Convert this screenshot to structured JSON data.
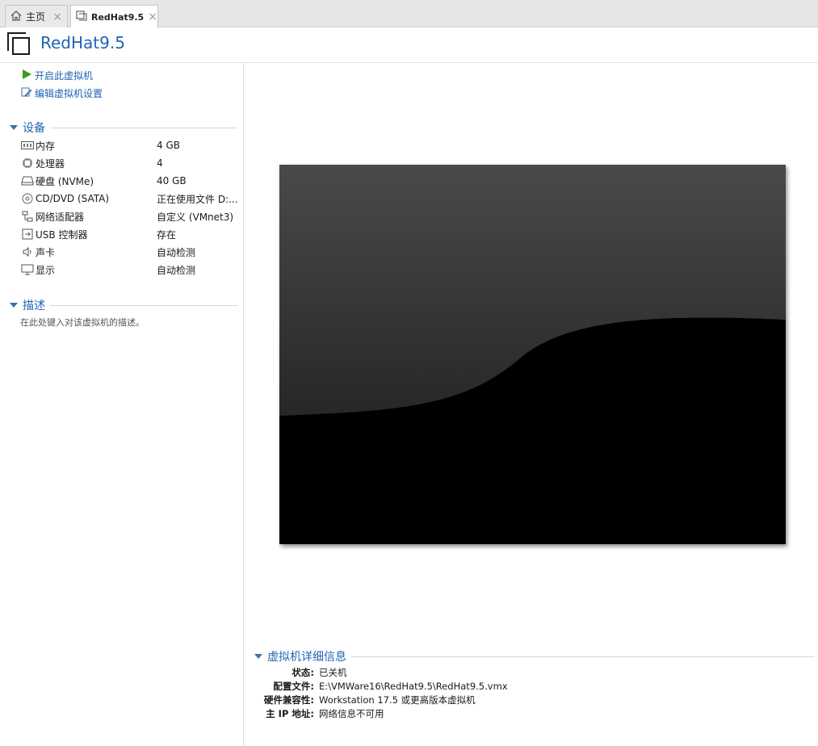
{
  "tabs": [
    {
      "label": "主页",
      "icon": "home-icon"
    },
    {
      "label": "RedHat9.5",
      "icon": "vm-icon"
    }
  ],
  "header": {
    "title": "RedHat9.5"
  },
  "actions": {
    "power_on": "开启此虚拟机",
    "edit_settings": "编辑虚拟机设置"
  },
  "devices": {
    "section_label": "设备",
    "items": [
      {
        "name": "内存",
        "value": "4 GB",
        "icon": "memory-icon"
      },
      {
        "name": "处理器",
        "value": "4",
        "icon": "cpu-icon"
      },
      {
        "name": "硬盘 (NVMe)",
        "value": "40 GB",
        "icon": "hard-disk-icon"
      },
      {
        "name": "CD/DVD (SATA)",
        "value": "正在使用文件 D:...",
        "icon": "cd-dvd-icon"
      },
      {
        "name": "网络适配器",
        "value": "自定义 (VMnet3)",
        "icon": "network-adapter-icon"
      },
      {
        "name": "USB 控制器",
        "value": "存在",
        "icon": "usb-icon"
      },
      {
        "name": "声卡",
        "value": "自动检测",
        "icon": "sound-card-icon"
      },
      {
        "name": "显示",
        "value": "自动检测",
        "icon": "display-icon"
      }
    ]
  },
  "description": {
    "section_label": "描述",
    "placeholder": "在此处键入对该虚拟机的描述。"
  },
  "details": {
    "section_label": "虚拟机详细信息",
    "rows": [
      {
        "key": "状态:",
        "value": "已关机"
      },
      {
        "key": "配置文件:",
        "value": "E:\\VMWare16\\RedHat9.5\\RedHat9.5.vmx"
      },
      {
        "key": "硬件兼容性:",
        "value": "Workstation 17.5 或更高版本虚拟机"
      },
      {
        "key": "主 IP 地址:",
        "value": "网络信息不可用"
      }
    ]
  },
  "colors": {
    "accent": "#1f64b4",
    "power_green": "#3a9a1e",
    "preview_bg": "#000000"
  }
}
